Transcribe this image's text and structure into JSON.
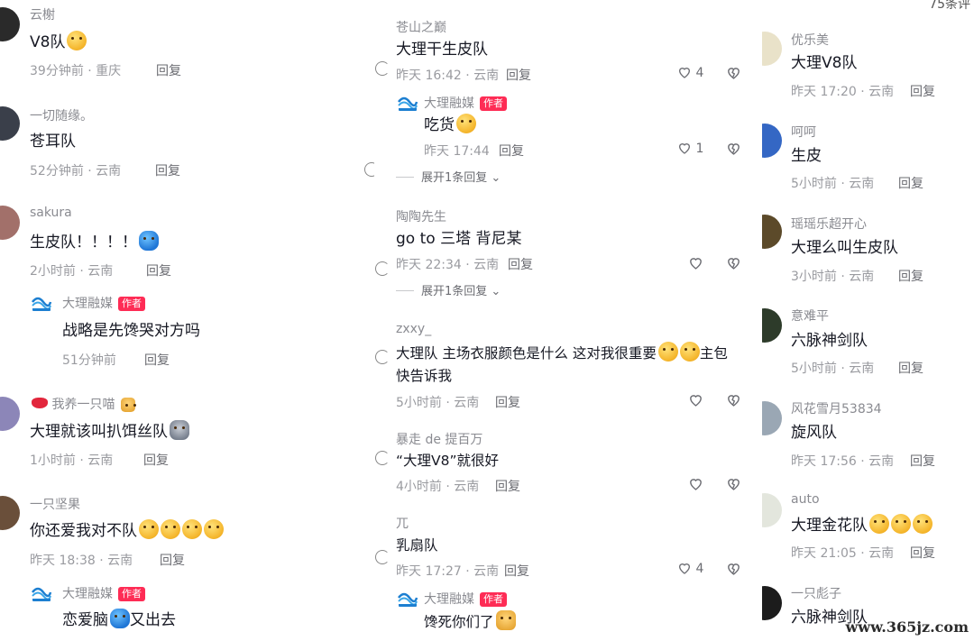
{
  "left": {
    "comments": [
      {
        "user": "云榭",
        "text": "V8队",
        "time": "39分钟前 · 重庆",
        "reply": "回复"
      },
      {
        "user": "一切随缘。",
        "text": "苍耳队",
        "time": "52分钟前 · 云南",
        "reply": "回复"
      },
      {
        "user": "sakura",
        "text": "生皮队！！！！",
        "time": "2小时前 · 云南",
        "reply": "回复"
      },
      {
        "user": "大理融媒",
        "badge": "作者",
        "text": "战略是先馋哭对方吗",
        "time": "51分钟前",
        "reply": "回复"
      },
      {
        "user": "我养一只喵",
        "text": "大理就该叫扒饵丝队",
        "time": "1小时前 · 云南",
        "reply": "回复"
      },
      {
        "user": "一只坚果",
        "text": "你还爱我对不队",
        "time": "昨天 18:38 · 云南",
        "reply": "回复"
      },
      {
        "user": "大理融媒",
        "badge": "作者",
        "text": "恋爱脑",
        "text2": "又出去"
      }
    ]
  },
  "mid": {
    "comments": [
      {
        "user": "苍山之巅",
        "text": "大理干生皮队",
        "time": "昨天 16:42 · 云南",
        "reply": "回复",
        "likes": "4"
      },
      {
        "user": "大理融媒",
        "badge": "作者",
        "text": "吃货",
        "time": "昨天 17:44",
        "reply": "回复",
        "likes": "1"
      },
      {
        "expand": "展开1条回复"
      },
      {
        "user": "陶陶先生",
        "text": "go to 三塔  背尼某",
        "time": "昨天 22:34 · 云南",
        "reply": "回复"
      },
      {
        "expand": "展开1条回复"
      },
      {
        "user": "zxxy_",
        "text": "大理队 主场衣服颜色是什么 这对我很重要",
        "text_tail": "主包",
        "text_line2": "快告诉我",
        "time": "5小时前 · 云南",
        "reply": "回复"
      },
      {
        "user": "暴走 de 提百万",
        "text": "“大理V8”就很好",
        "time": "4小时前 · 云南",
        "reply": "回复"
      },
      {
        "user": "兀",
        "text": "乳扇队",
        "time": "昨天 17:27 · 云南",
        "reply": "回复",
        "likes": "4"
      },
      {
        "user": "大理融媒",
        "badge": "作者",
        "text": "馋死你们了"
      }
    ]
  },
  "right": {
    "top_count": "75条评",
    "comments": [
      {
        "user": "优乐美",
        "text": "大理V8队",
        "time": "昨天 17:20 · 云南",
        "reply": "回复"
      },
      {
        "user": "呵呵",
        "text": "生皮",
        "time": "5小时前 · 云南",
        "reply": "回复"
      },
      {
        "user": "瑶瑶乐超开心",
        "text": "大理么叫生皮队",
        "time": "3小时前 · 云南",
        "reply": "回复"
      },
      {
        "user": "意难平",
        "text": "六脉神剑队",
        "time": "5小时前 · 云南",
        "reply": "回复"
      },
      {
        "user": "风花雪月53834",
        "text": "旋风队",
        "time": "昨天 17:56 · 云南",
        "reply": "回复"
      },
      {
        "user": "auto",
        "text": "大理金花队",
        "time": "昨天 21:05 · 云南",
        "reply": "回复"
      },
      {
        "user": "一只彪子",
        "text": "六脉神剑队"
      }
    ]
  },
  "watermark": "www.365jz.com"
}
